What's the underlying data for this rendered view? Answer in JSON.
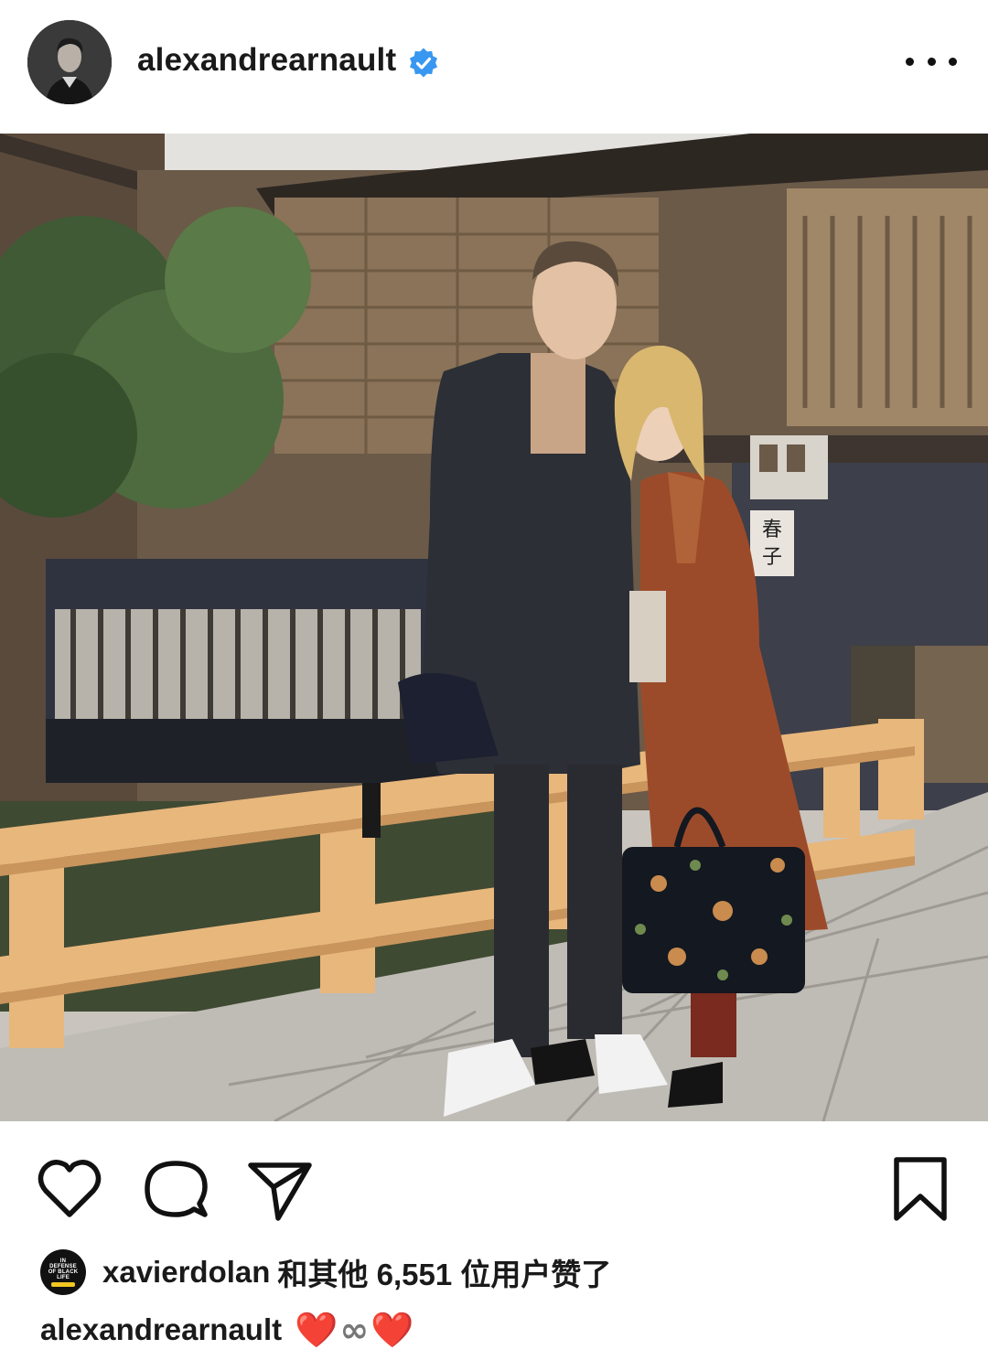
{
  "post": {
    "username": "alexandrearnault",
    "verified": true,
    "verified_color": "#3897f0",
    "more_icon": "more-horizontal-icon"
  },
  "photo": {
    "subject": "street-photo",
    "colors": {
      "sky": "#e4e2de",
      "wood": "#6b5a48",
      "railing": "#e8b77c",
      "coat_dark": "#2c2f36",
      "coat_brown": "#9c4b2a",
      "pavement": "#bfbcb6"
    },
    "sign_text": "春子"
  },
  "actions": {
    "icons": [
      "heart-icon",
      "comment-icon",
      "share-icon",
      "bookmark-icon"
    ]
  },
  "likes": {
    "liker_avatar_text": "IN DEFENSE OF BLACK LIFE",
    "liker_username": "xavierdolan",
    "likes_text": "和其他 6,551 位用户赞了"
  },
  "caption": {
    "username": "alexandrearnault",
    "heart_left": "❤️",
    "infinity": "∞",
    "heart_right": "❤️"
  }
}
